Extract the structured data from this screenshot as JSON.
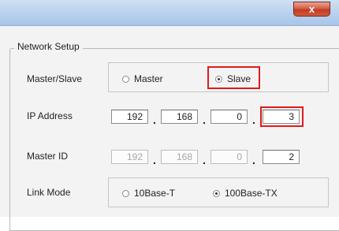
{
  "window": {
    "close_label": "x"
  },
  "group": {
    "title": "Network Setup"
  },
  "master_slave": {
    "label": "Master/Slave",
    "options": [
      "Master",
      "Slave"
    ],
    "selected": "Slave"
  },
  "ip_address": {
    "label": "IP Address",
    "octets": [
      "192",
      "168",
      "0",
      "3"
    ],
    "separator": "."
  },
  "master_id": {
    "label": "Master ID",
    "octets": [
      "192",
      "168",
      "0",
      "2"
    ],
    "separator": "."
  },
  "link_mode": {
    "label": "Link Mode",
    "options": [
      "10Base-T",
      "100Base-TX"
    ],
    "selected": "100Base-TX"
  },
  "colors": {
    "highlight": "#e11a1a",
    "titlebar": "#bcd3ee",
    "close_button": "#c23b22"
  }
}
